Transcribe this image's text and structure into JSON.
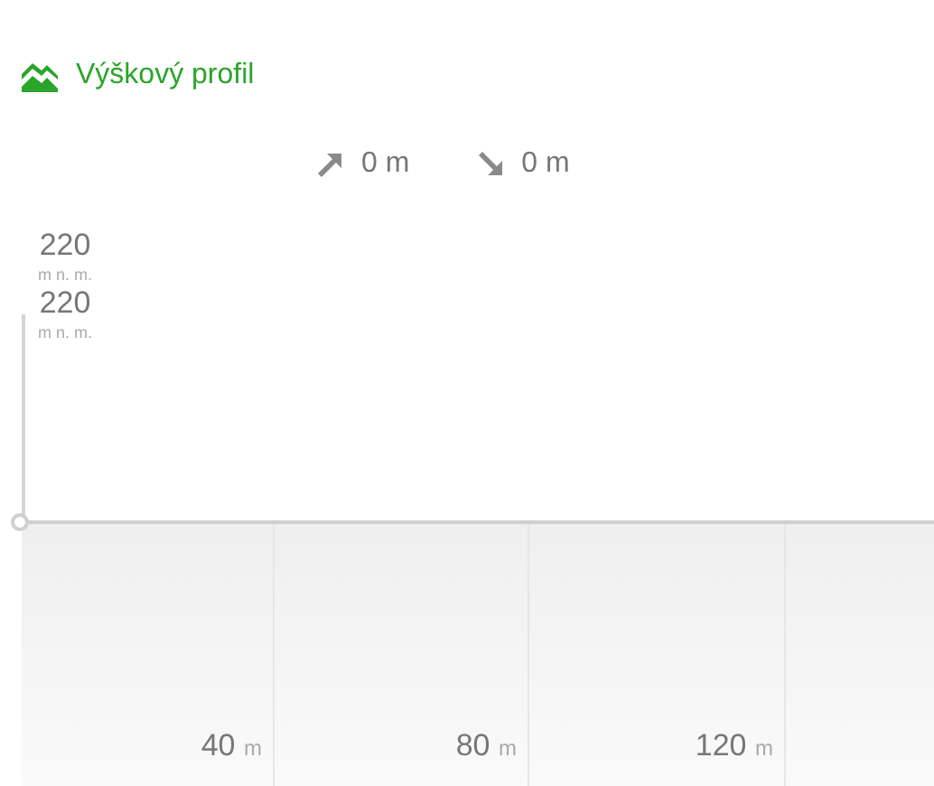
{
  "header": {
    "title": "Výškový profil"
  },
  "stats": [
    {
      "kind": "ascent",
      "value": "0 m"
    },
    {
      "kind": "descent",
      "value": "0 m"
    }
  ],
  "y_labels": [
    {
      "value": "220",
      "unit": "m n. m."
    },
    {
      "value": "220",
      "unit": "m n. m."
    }
  ],
  "x_labels": [
    {
      "value": "40",
      "unit": "m"
    },
    {
      "value": "80",
      "unit": "m"
    },
    {
      "value": "120",
      "unit": "m"
    }
  ]
}
